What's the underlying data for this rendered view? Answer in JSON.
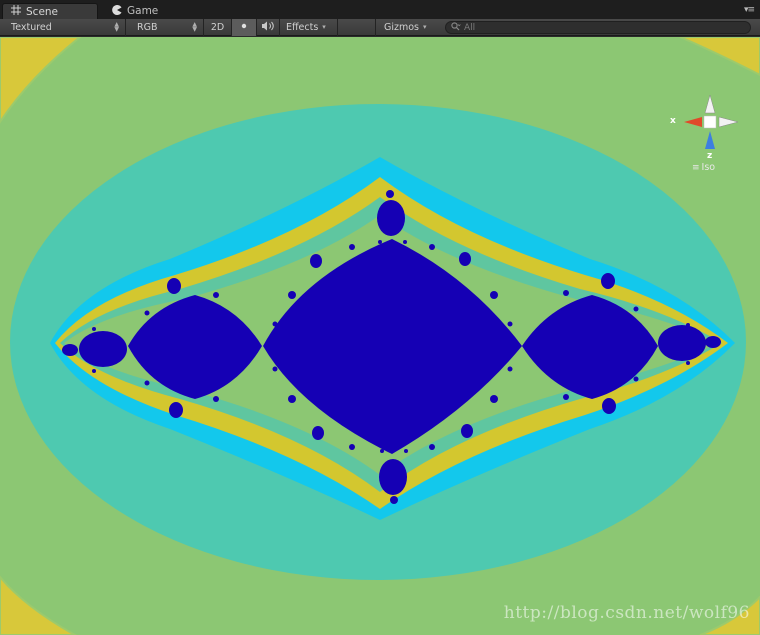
{
  "tabs": [
    {
      "label": "Scene",
      "icon": "grid-icon"
    },
    {
      "label": "Game",
      "icon": "pacman-icon"
    }
  ],
  "toolbar": {
    "shading_mode": "Textured",
    "render_mode": "RGB",
    "mode_2d": "2D",
    "effects_label": "Effects",
    "gizmos_label": "Gizmos",
    "search_placeholder": "All"
  },
  "gizmo": {
    "x_label": "x",
    "z_label": "z",
    "projection_label": "Iso"
  },
  "watermark": "http://blog.csdn.net/wolf96",
  "colors": {
    "background": "#8cc773",
    "teal": "#4ec9b0",
    "cyan": "#13c8ec",
    "yellow": "#d3c72f",
    "set_blue": "#1500b4",
    "corner_yellow": "#d8c83a"
  }
}
